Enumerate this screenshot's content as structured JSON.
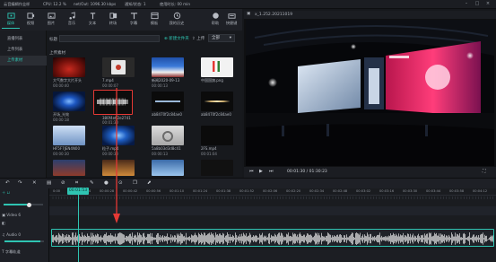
{
  "titlebar": {
    "app_title": "云音编辑作业样",
    "cpu": "CPU: 12.2 %",
    "net": "net/Out: 1096.30 kbps",
    "count": "通知/状态: 1",
    "used_time": "使用时长: 00 min"
  },
  "toolbar": {
    "items": [
      {
        "label": "媒体",
        "icon": "film-icon"
      },
      {
        "label": "视频",
        "icon": "video-icon"
      },
      {
        "label": "图片",
        "icon": "image-icon"
      },
      {
        "label": "音乐",
        "icon": "music-icon"
      },
      {
        "label": "文本",
        "icon": "text-icon"
      },
      {
        "label": "转场",
        "icon": "transition-icon"
      },
      {
        "label": "字幕",
        "icon": "subtitle-icon"
      },
      {
        "label": "模板",
        "icon": "template-icon"
      },
      {
        "label": "我的历史",
        "icon": "history-icon"
      }
    ],
    "right_items": [
      {
        "label": "帮助",
        "icon": "help-icon"
      },
      {
        "label": "快捷键",
        "icon": "keyboard-icon"
      }
    ]
  },
  "sidebar": {
    "items": [
      {
        "label": "直播列表",
        "active": false
      },
      {
        "label": "上传列表",
        "active": false
      },
      {
        "label": "上传素材",
        "active": true
      }
    ]
  },
  "media": {
    "search_label": "标题",
    "new_folder": "新建文件夹",
    "upload": "上传",
    "filter": "全部",
    "section_title": "上传素材",
    "items": [
      {
        "name": "大气数字大片开头",
        "duration": "00:00:40"
      },
      {
        "name": "7.mp4",
        "duration": "00:00:07"
      },
      {
        "name": "新闻2020-09-13",
        "duration": "00:00:13"
      },
      {
        "name": "中国国旗.png",
        "duration": ""
      },
      {
        "name": "开场_光效",
        "duration": "00:00:18"
      },
      {
        "name": "380f4e62e2741",
        "duration": "00:01:30"
      },
      {
        "name": "ab8470f2c84ae0",
        "duration": ""
      },
      {
        "name": "ab8470f2c84ae0",
        "duration": ""
      },
      {
        "name": "HF5F7JEN4N00",
        "duration": "00:00:30"
      },
      {
        "name": "粒子.mp4",
        "duration": "00:00:30"
      },
      {
        "name": "5a8b03d3d8c41",
        "duration": "00:00:13"
      },
      {
        "name": "2FS.mp4",
        "duration": "00:01:04"
      }
    ]
  },
  "preview": {
    "title": "x_1.252.20211019",
    "timecode": "00:01:30 / 01:30:23"
  },
  "timeline": {
    "playhead": "00:01:53",
    "ruler": [
      "0:00",
      "00:00:14",
      "00:00:28",
      "00:00:42",
      "00:00:56",
      "00:01:10",
      "00:01:24",
      "00:01:38",
      "00:01:52",
      "00:02:06",
      "00:02:20",
      "00:02:34",
      "00:02:48",
      "00:03:02",
      "00:03:16",
      "00:03:30",
      "00:03:44",
      "00:03:58",
      "00:04:12"
    ],
    "tracks": [
      {
        "label": "Video 6",
        "icon": "video-track-icon"
      },
      {
        "label": "Audio 0",
        "icon": "audio-track-icon"
      },
      {
        "label": "字幕轨道",
        "icon": "text-track-icon"
      }
    ]
  },
  "colors": {
    "accent": "#2fc4b2",
    "highlight_red": "#e53935"
  }
}
